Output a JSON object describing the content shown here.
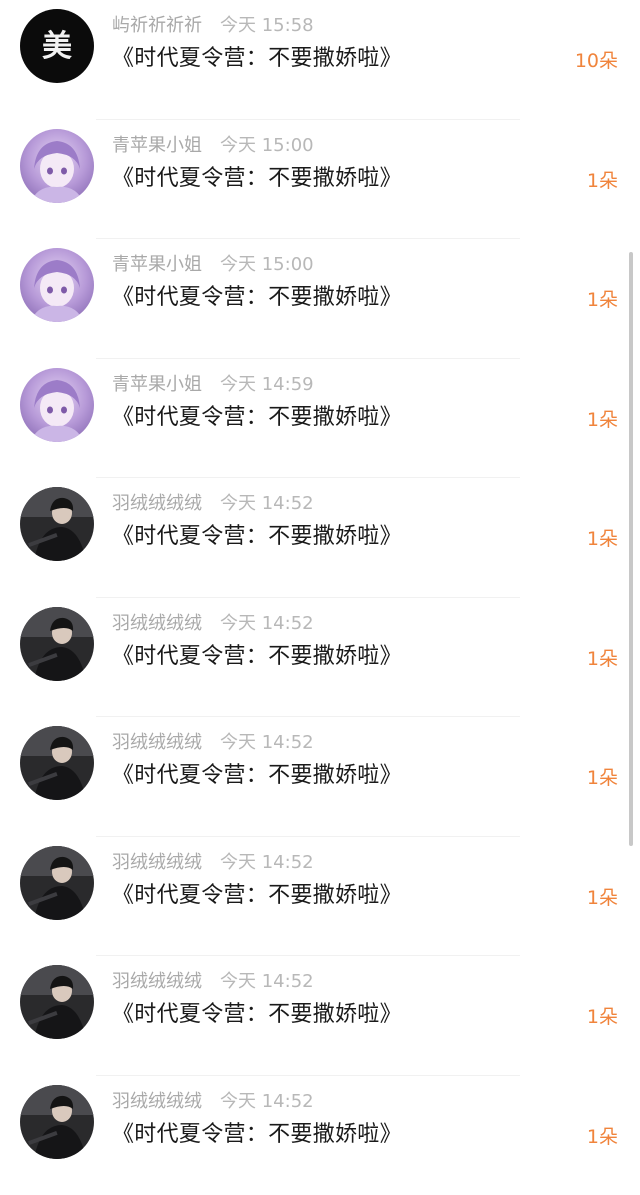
{
  "messages": [
    {
      "name": "屿祈祈祈祈",
      "time": "今天 15:58",
      "text": "《时代夏令营：不要撒娇啦》",
      "count": "10朵",
      "avatar": "avatar-black-logo"
    },
    {
      "name": "青苹果小姐",
      "time": "今天 15:00",
      "text": "《时代夏令营：不要撒娇啦》",
      "count": "1朵",
      "avatar": "avatar-purple-anime"
    },
    {
      "name": "青苹果小姐",
      "time": "今天 15:00",
      "text": "《时代夏令营：不要撒娇啦》",
      "count": "1朵",
      "avatar": "avatar-purple-anime"
    },
    {
      "name": "青苹果小姐",
      "time": "今天 14:59",
      "text": "《时代夏令营：不要撒娇啦》",
      "count": "1朵",
      "avatar": "avatar-purple-anime"
    },
    {
      "name": "羽绒绒绒绒",
      "time": "今天 14:52",
      "text": "《时代夏令营：不要撒娇啦》",
      "count": "1朵",
      "avatar": "avatar-dark-photo"
    },
    {
      "name": "羽绒绒绒绒",
      "time": "今天 14:52",
      "text": "《时代夏令营：不要撒娇啦》",
      "count": "1朵",
      "avatar": "avatar-dark-photo"
    },
    {
      "name": "羽绒绒绒绒",
      "time": "今天 14:52",
      "text": "《时代夏令营：不要撒娇啦》",
      "count": "1朵",
      "avatar": "avatar-dark-photo"
    },
    {
      "name": "羽绒绒绒绒",
      "time": "今天 14:52",
      "text": "《时代夏令营：不要撒娇啦》",
      "count": "1朵",
      "avatar": "avatar-dark-photo"
    },
    {
      "name": "羽绒绒绒绒",
      "time": "今天 14:52",
      "text": "《时代夏令营：不要撒娇啦》",
      "count": "1朵",
      "avatar": "avatar-dark-photo"
    },
    {
      "name": "羽绒绒绒绒",
      "time": "今天 14:52",
      "text": "《时代夏令营：不要撒娇啦》",
      "count": "1朵",
      "avatar": "avatar-dark-photo"
    }
  ],
  "colors": {
    "accent": "#f0843c",
    "meta": "#a9a9a9",
    "text": "#1a1a1a"
  }
}
